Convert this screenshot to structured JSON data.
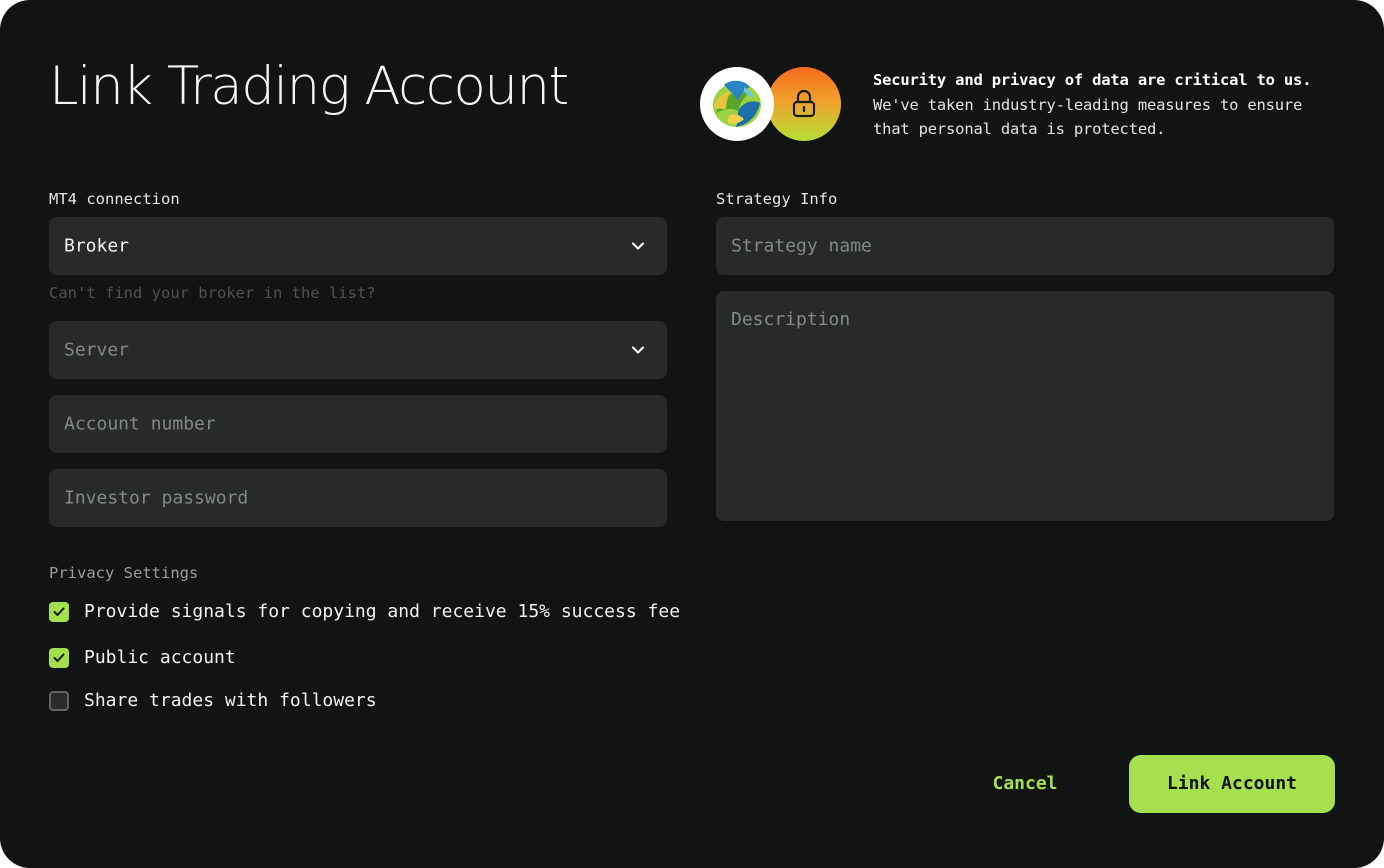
{
  "dialog": {
    "title": "Link Trading Account"
  },
  "security": {
    "bold_text": "Security and privacy of data are critical to us.",
    "body_text": " We've taken industry-leading measures to ensure that personal data is protected.",
    "icons": [
      "metatrader-logo-icon",
      "lock-icon"
    ],
    "lock_gradient": [
      "#f6691e",
      "#f1a02a",
      "#b6df37"
    ]
  },
  "mt4": {
    "section_label": "MT4 connection",
    "broker": {
      "value": "Broker",
      "icon": "chevron-down-icon"
    },
    "helper": "Can't find your broker in the list?",
    "server": {
      "placeholder": "Server",
      "icon": "chevron-down-icon"
    },
    "account_number": {
      "placeholder": "Account number"
    },
    "investor_password": {
      "placeholder": "Investor password"
    }
  },
  "strategy": {
    "section_label": "Strategy Info",
    "name": {
      "placeholder": "Strategy name"
    },
    "description": {
      "placeholder": "Description"
    }
  },
  "privacy": {
    "section_label": "Privacy Settings",
    "options": [
      {
        "label": "Provide signals for copying and receive 15% success fee",
        "checked": true
      },
      {
        "label": "Public account",
        "checked": true
      },
      {
        "label": "Share trades with followers",
        "checked": false
      }
    ]
  },
  "actions": {
    "cancel_label": "Cancel",
    "submit_label": "Link Account"
  },
  "colors": {
    "background": "#121313",
    "field": "#272a28",
    "accent": "#a6e04e",
    "placeholder": "#828a85"
  }
}
